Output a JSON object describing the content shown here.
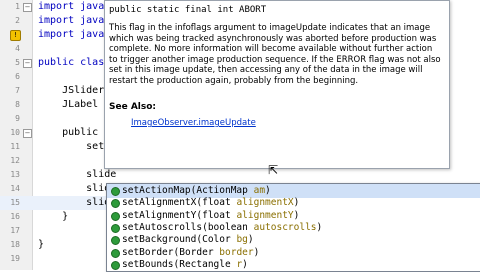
{
  "editor": {
    "lines": [
      {
        "num": "1",
        "fold": "−",
        "text": "import javax",
        "cls": "kw-prefix"
      },
      {
        "num": "2",
        "fold": "",
        "text": "import java.",
        "cls": "kw-prefix"
      },
      {
        "num": "3",
        "fold": "",
        "text": "import javax",
        "cls": "kw-prefix"
      },
      {
        "num": "4",
        "fold": "",
        "text": "",
        "cls": ""
      },
      {
        "num": "5",
        "fold": "−",
        "text": "public clas",
        "cls": "kw-prefix"
      },
      {
        "num": "6",
        "fold": "",
        "text": "",
        "cls": ""
      },
      {
        "num": "7",
        "fold": "",
        "text": "    JSlider",
        "cls": ""
      },
      {
        "num": "8",
        "fold": "",
        "text": "    JLabel l",
        "cls": ""
      },
      {
        "num": "9",
        "fold": "",
        "text": "",
        "cls": ""
      },
      {
        "num": "10",
        "fold": "−",
        "text": "    public s",
        "cls": ""
      },
      {
        "num": "11",
        "fold": "",
        "text": "        setL",
        "cls": ""
      },
      {
        "num": "12",
        "fold": "",
        "text": "",
        "cls": ""
      },
      {
        "num": "13",
        "fold": "",
        "text": "        slide",
        "cls": ""
      },
      {
        "num": "14",
        "fold": "",
        "text": "        slid",
        "cls": ""
      },
      {
        "num": "15",
        "fold": "",
        "text": "        slider.set",
        "cls": "current"
      },
      {
        "num": "16",
        "fold": "",
        "text": "    }",
        "cls": ""
      },
      {
        "num": "17",
        "fold": "",
        "text": "",
        "cls": ""
      },
      {
        "num": "18",
        "fold": "",
        "text": "}",
        "cls": ""
      },
      {
        "num": "19",
        "fold": "",
        "text": "",
        "cls": ""
      }
    ],
    "warning_glyph": "!"
  },
  "javadoc": {
    "signature": "public static final int ABORT",
    "body": "This flag in the infoflags argument to imageUpdate indicates that an image which was being tracked asynchronously was aborted before production was complete. No more information will become available without further action to trigger another image production sequence. If the ERROR flag was not also set in this image update, then accessing any of the data in the image will restart the production again, probably from the beginning.",
    "see_also": "See Also:",
    "link": "ImageObserver.imageUpdate"
  },
  "completion": {
    "items": [
      {
        "name": "setActionMap",
        "ptype": "ActionMap",
        "pname": "am"
      },
      {
        "name": "setAlignmentX",
        "ptype": "float",
        "pname": "alignmentX"
      },
      {
        "name": "setAlignmentY",
        "ptype": "float",
        "pname": "alignmentY"
      },
      {
        "name": "setAutoscrolls",
        "ptype": "boolean",
        "pname": "autoscrolls"
      },
      {
        "name": "setBackground",
        "ptype": "Color",
        "pname": "bg"
      },
      {
        "name": "setBorder",
        "ptype": "Border",
        "pname": "border"
      },
      {
        "name": "setBounds",
        "ptype": "Rectangle",
        "pname": "r"
      }
    ],
    "selected_index": 0
  }
}
